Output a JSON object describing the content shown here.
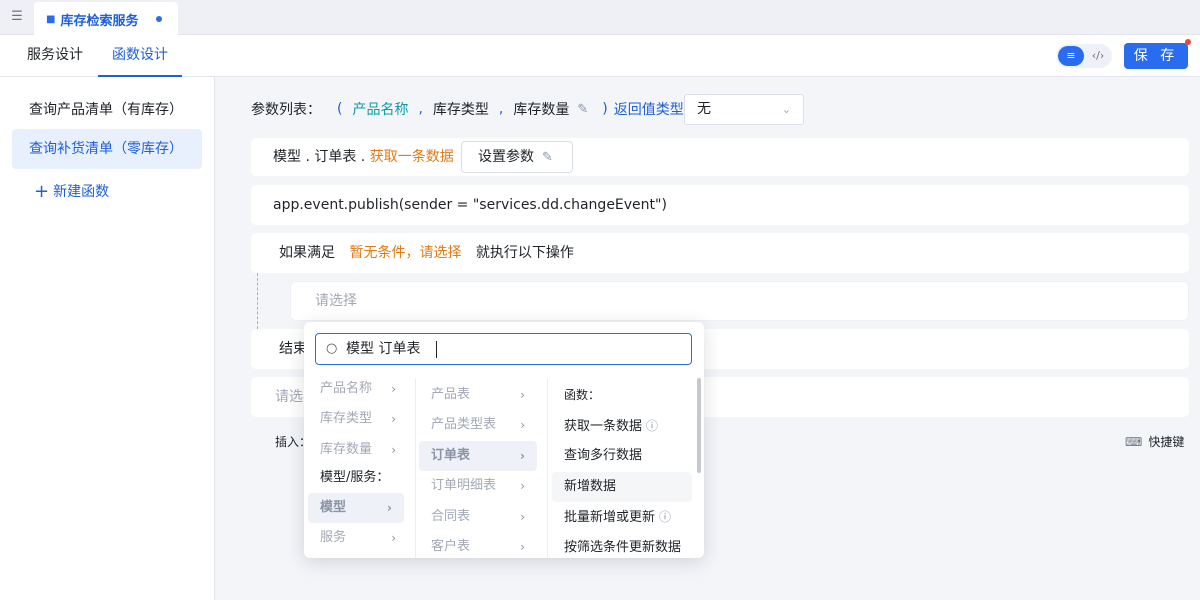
{
  "tab": {
    "title": "库存检索服务"
  },
  "subheader": {
    "tabs": [
      "服务设计",
      "函数设计"
    ],
    "save_label": "保 存"
  },
  "sidebar": {
    "items": [
      "查询产品清单（有库存）",
      "查询补货清单（零库存）"
    ],
    "new_label": "新建函数"
  },
  "params": {
    "label": "参数列表：",
    "open_paren": "(",
    "p1": "产品名称",
    "comma": ",",
    "p2": "库存类型",
    "p3": "库存数量",
    "close_paren": ")",
    "return_label": "返回值类型",
    "return_value": "无"
  },
  "steps": {
    "model_prefix": "模型 . 订单表 .",
    "model_fn": "获取一条数据",
    "set_param_label": "设置参数",
    "code_line": "app.event.publish(sender = \"services.dd.changeEvent\")",
    "if_label": "如果满足",
    "if_cond": "暂无条件，请选择",
    "if_then": "就执行以下操作",
    "inner_placeholder": "请选择",
    "end_label": "结束",
    "bottom_placeholder": "请选",
    "insert_label": "插入：",
    "shortcut_label": "快捷键"
  },
  "popup": {
    "search_value": "模型 订单表",
    "col1": [
      {
        "label": "产品名称"
      },
      {
        "label": "库存类型"
      },
      {
        "label": "库存数量"
      },
      {
        "label": "模型/服务："
      },
      {
        "label": "模型"
      },
      {
        "label": "服务"
      }
    ],
    "col2": [
      "产品表",
      "产品类型表",
      "订单表",
      "订单明细表",
      "合同表",
      "客户表"
    ],
    "col3_header": "函数：",
    "col3": [
      "获取一条数据",
      "查询多行数据",
      "新增数据",
      "批量新增或更新",
      "按筛选条件更新数据"
    ]
  },
  "colors": {
    "accent": "#2a6cf0",
    "param_teal": "#0f9aa6",
    "warn_orange": "#e07b16"
  },
  "icons": [
    "sidebar-toggle-icon",
    "database-icon",
    "settings-icon",
    "code-icon",
    "edit-icon",
    "chevron-down-icon",
    "plus-icon",
    "search-icon",
    "chevron-right-icon",
    "info-icon",
    "keyboard-icon"
  ]
}
